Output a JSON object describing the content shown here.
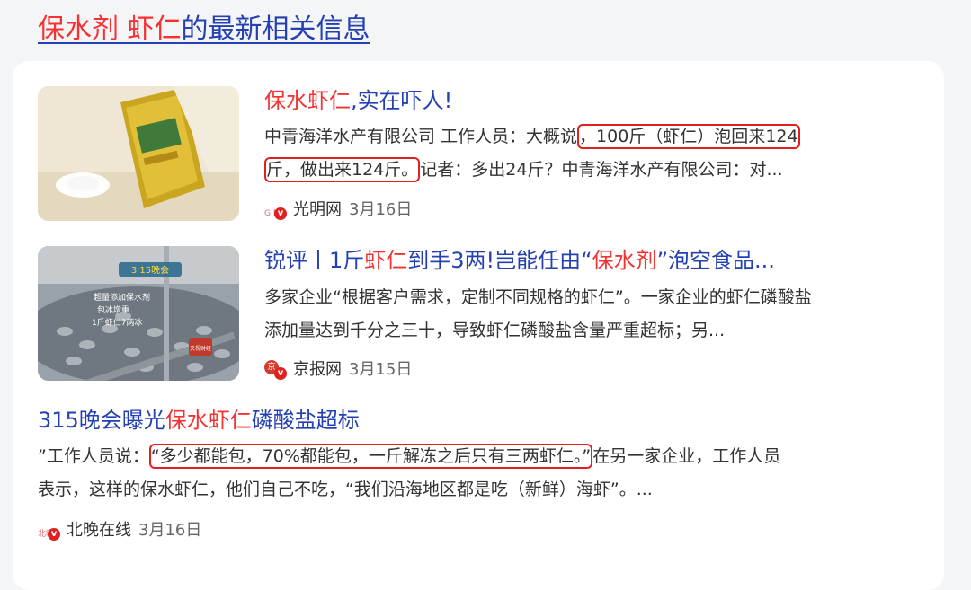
{
  "section_title": {
    "highlight": "保水剂 虾仁",
    "rest": "的最新相关信息"
  },
  "colors": {
    "link_blue": "#2440b3",
    "highlight_red": "#f73131",
    "annotation_red": "#e02020"
  },
  "results": [
    {
      "headline_parts": {
        "h1": "保水虾仁",
        "t1": ",实在吓人!"
      },
      "snippet_line1_pre": "中青海洋水产有限公司 工作人员：大概说",
      "snippet_line1_mark": "，100斤（虾仁）泡回来124",
      "snippet_line2_mark": "斤，做出来124斤。",
      "snippet_line2_post": "记者：多出24斤？中青海洋水产有限公司：对...",
      "source": "光明网",
      "date": "3月16日",
      "source_icon": "guangming-logo-icon",
      "thumb_caption": ""
    },
    {
      "headline_parts": {
        "t1": "锐评丨1斤",
        "h1": "虾仁",
        "t2": "到手3两!岂能任由“",
        "h2": "保水剂",
        "t3": "”泡空食品..."
      },
      "snippet_line1": "多家企业“根据客户需求，定制不同规格的虾仁”。一家企业的虾仁磷酸盐",
      "snippet_line2": "添加量达到千分之三十，导致虾仁磷酸盐含量严重超标；另...",
      "source": "京报网",
      "date": "3月15日",
      "source_icon": "jingbao-logo-icon",
      "thumb_texts": [
        "3·15晚会",
        "超量添加保水剂",
        "包冰增重",
        "1斤虾仁7两冰",
        "央视财经"
      ]
    },
    {
      "headline_parts": {
        "t1": "315晚会曝光",
        "h1": "保水虾仁",
        "t2": "磷酸盐超标"
      },
      "snippet_line1_pre": "”工作人员说：",
      "snippet_line1_mark": "“多少都能包，70%都能包，一斤解冻之后只有三两虾仁。”",
      "snippet_line1_post": "在另一家企业，工作人员",
      "snippet_line2": "表示，这样的保水虾仁，他们自己不吃，“我们沿海地区都是吃（新鲜）海虾”。...",
      "source": "北晚在线",
      "date": "3月16日",
      "source_icon": "beiwan-logo-icon"
    }
  ]
}
